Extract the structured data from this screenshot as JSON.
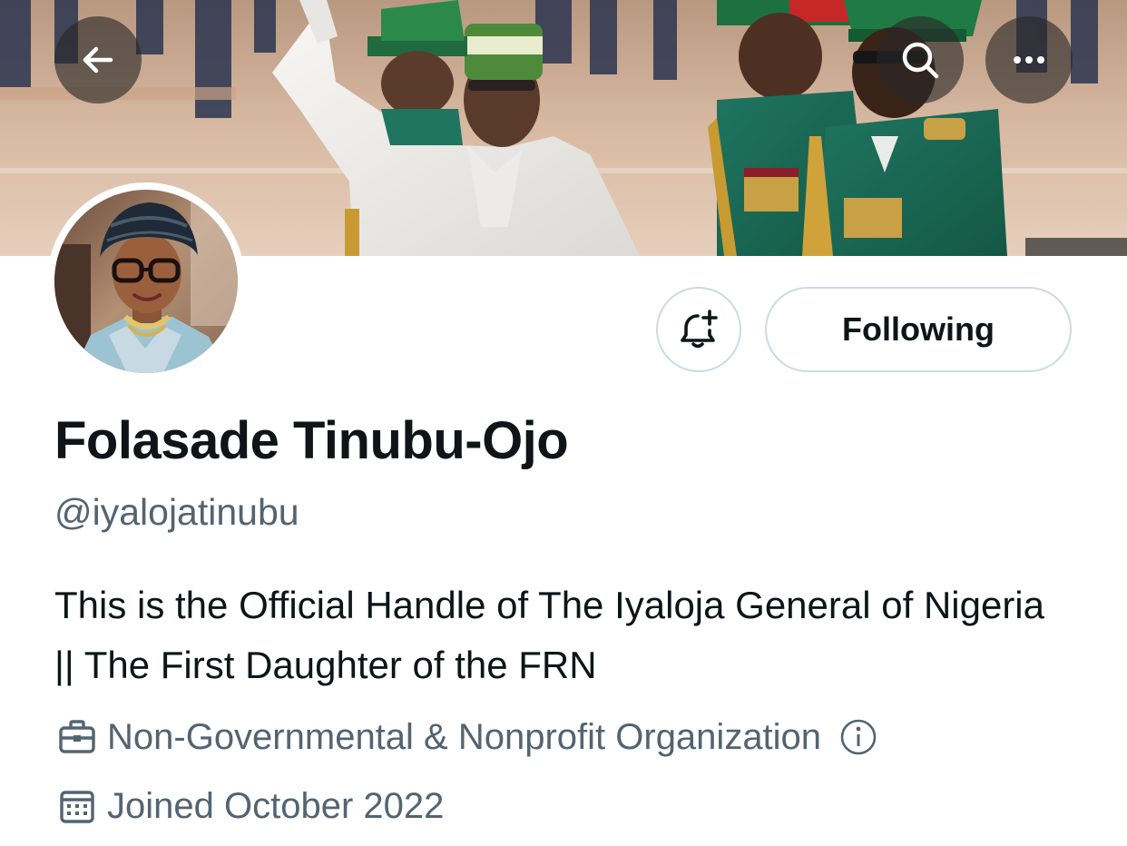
{
  "header": {
    "back_icon": "arrow-left-icon",
    "search_icon": "search-icon",
    "more_icon": "more-horizontal-icon"
  },
  "banner": {
    "description_icon": "banner-photo"
  },
  "profile": {
    "display_name": "Folasade Tinubu-Ojo",
    "handle": "@iyalojatinubu",
    "bio": "This is the Official Handle of The Iyaloja General of Nigeria || The First Daughter of the FRN",
    "category": "Non-Governmental & Nonprofit Organization",
    "joined": "Joined October 2022"
  },
  "actions": {
    "notify_icon": "bell-plus-icon",
    "following_label": "Following"
  },
  "colors": {
    "text_primary": "#0f1419",
    "text_secondary": "#536471",
    "border": "#cfd9de"
  }
}
